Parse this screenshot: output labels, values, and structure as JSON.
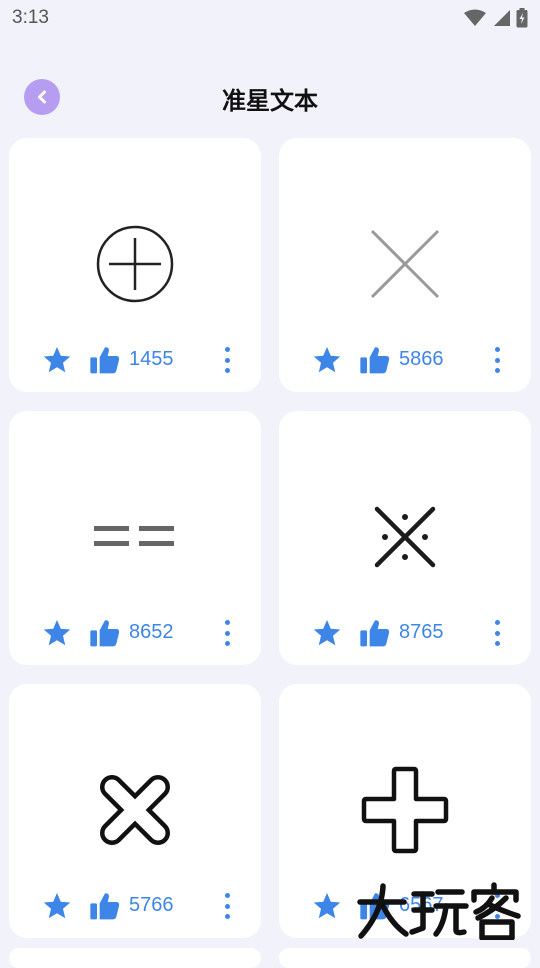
{
  "status_bar": {
    "time": "3:13"
  },
  "header": {
    "title": "准星文本"
  },
  "cards": [
    {
      "symbol": "circle-plus",
      "likes": "1455"
    },
    {
      "symbol": "thin-x",
      "likes": "5866"
    },
    {
      "symbol": "double-dash",
      "likes": "8652"
    },
    {
      "symbol": "dotted-x",
      "likes": "8765"
    },
    {
      "symbol": "bold-outline-x",
      "likes": "5766"
    },
    {
      "symbol": "bold-outline-plus",
      "likes": "6567"
    }
  ],
  "watermark": {
    "text": "大玩客"
  },
  "colors": {
    "accent": "#3d86e8",
    "back_button": "#b69df1",
    "background": "#f2f2fb"
  }
}
